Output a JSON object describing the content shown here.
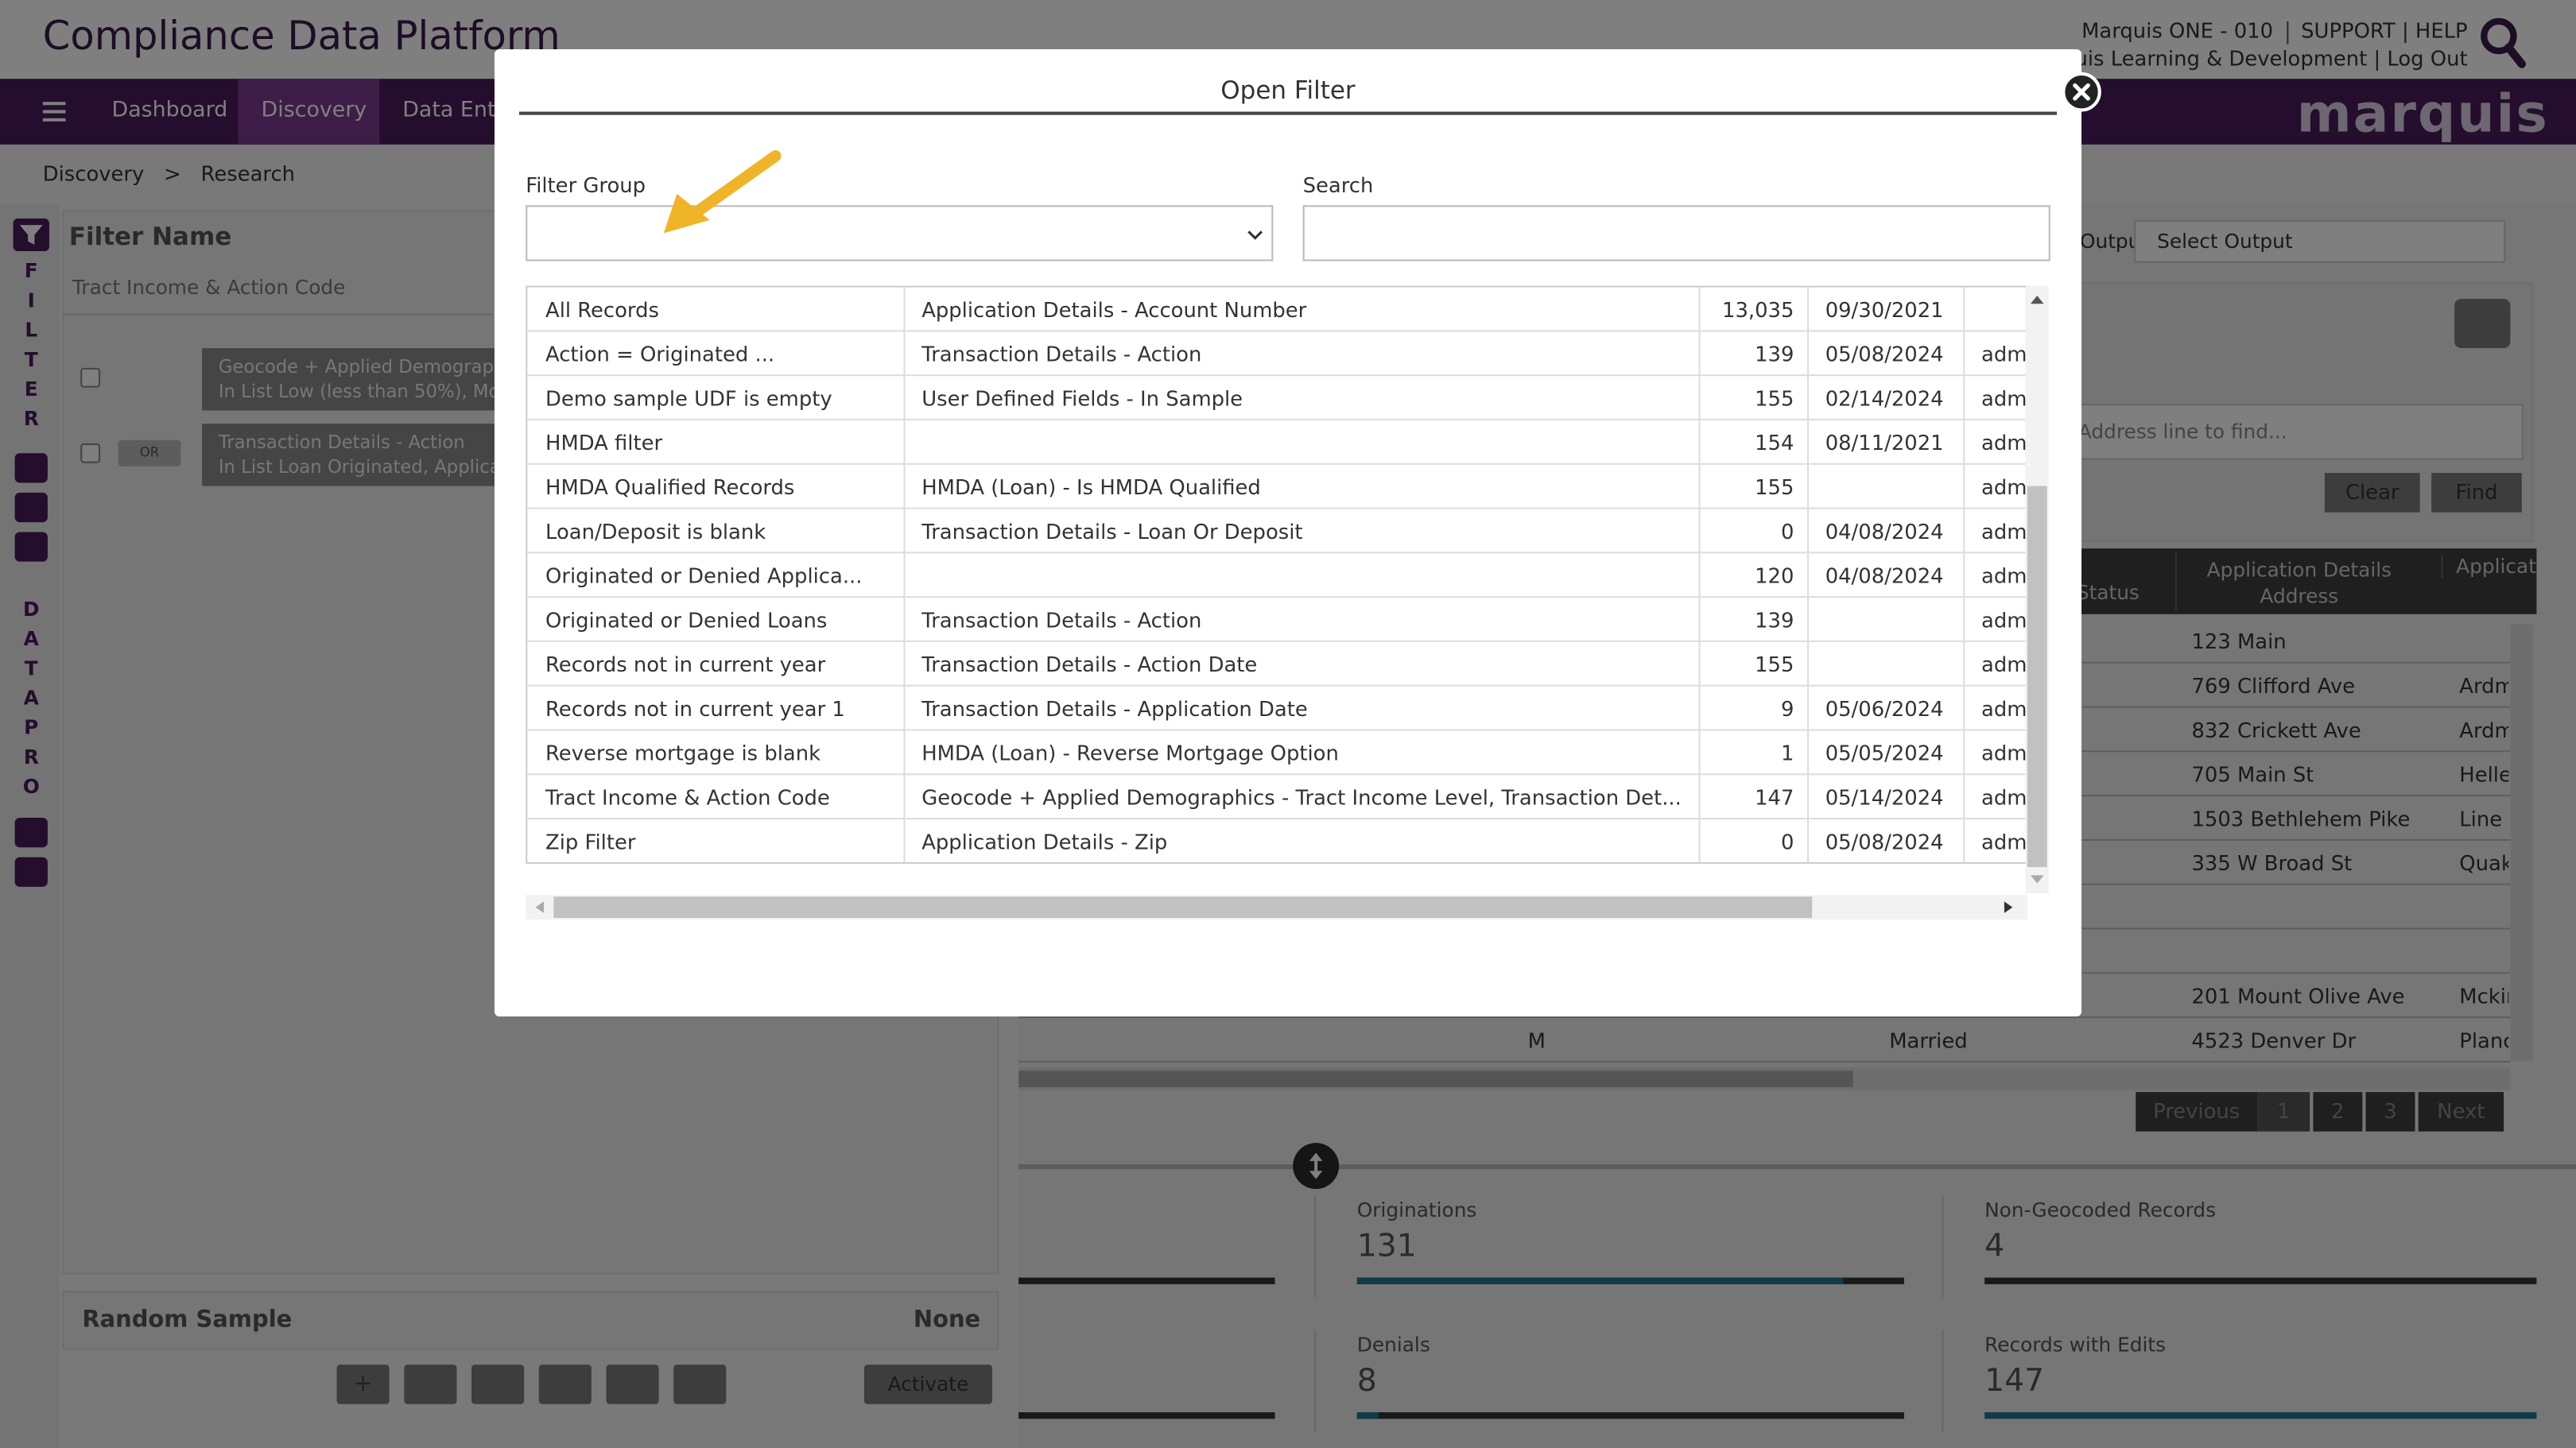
{
  "header": {
    "app_title": "Compliance Data Platform",
    "account": "Marquis ONE - 010",
    "support": "SUPPORT | HELP",
    "user_line": "Marquis Learning & Development | Log Out"
  },
  "nav": {
    "items": [
      "Dashboard",
      "Discovery",
      "Data Entry"
    ],
    "active": "Discovery",
    "logo": "marquis"
  },
  "breadcrumb": {
    "root": "Discovery",
    "sep": ">",
    "current": "Research"
  },
  "left_strip": {
    "word1": [
      "F",
      "I",
      "L",
      "T",
      "E",
      "R"
    ],
    "word2": [
      "D",
      "A",
      "T",
      "A",
      "P",
      "R",
      "O"
    ]
  },
  "filter_panel": {
    "name_label": "Filter Name",
    "name_value": "Tract Income & Action Code",
    "criteria": [
      {
        "line1": "Geocode + Applied Demographics",
        "line2": "In List Low (less than 50%), Mo"
      },
      {
        "line1": "Transaction Details - Action",
        "line2": "In List Loan Originated, Applica"
      }
    ],
    "or_label": "OR",
    "random_sample_label": "Random Sample",
    "random_sample_value": "None",
    "toolbar": {
      "add": "+",
      "activate": "Activate"
    }
  },
  "right_panel": {
    "output_label": "Output",
    "output_select": "Select Output",
    "address_placeholder": "Address line to find...",
    "clear": "Clear",
    "find": "Find",
    "col_status": "Status",
    "col_address": "Application Details Address",
    "col_next": "Applicat",
    "rows": [
      {
        "marital": "",
        "address": "123 Main",
        "next": ""
      },
      {
        "marital": "",
        "address": "769 Clifford Ave",
        "next": "Ardm"
      },
      {
        "marital": "",
        "address": "832 Crickett Ave",
        "next": "Ardm"
      },
      {
        "marital": "",
        "address": "705 Main St",
        "next": "Helle"
      },
      {
        "marital": "",
        "address": "1503 Bethlehem Pike",
        "next": "Line"
      },
      {
        "marital": "",
        "address": "335 W Broad St",
        "next": "Quak"
      },
      {
        "marital": "",
        "address": "",
        "next": ""
      },
      {
        "marital": "",
        "address": "",
        "next": ""
      },
      {
        "marital": "",
        "address": "201 Mount Olive Ave",
        "next": "Mckir"
      },
      {
        "sex": "M",
        "marital": "Married",
        "address": "4523 Denver Dr",
        "next": "Planc"
      }
    ],
    "pagination": {
      "previous": "Previous",
      "pages": [
        "1",
        "2",
        "3"
      ],
      "next": "Next"
    }
  },
  "stats": [
    {
      "label": "Originations",
      "value": "131",
      "fill": 0.89
    },
    {
      "label": "Non-Geocoded Records",
      "value": "4",
      "fill": 0.0
    },
    {
      "label": "Denials",
      "value": "8",
      "fill": 0.04
    },
    {
      "label": "Records with Edits",
      "value": "147",
      "fill": 1.0
    }
  ],
  "modal": {
    "title": "Open Filter",
    "filter_group_label": "Filter Group",
    "filter_group_value": "",
    "search_label": "Search",
    "search_value": "",
    "rows": [
      {
        "name": "All Records",
        "fields": "Application Details - Account Number",
        "count": "13,035",
        "date": "09/30/2021",
        "owner": ""
      },
      {
        "name": "Action = Originated ...",
        "fields": "Transaction Details - Action",
        "count": "139",
        "date": "05/08/2024",
        "owner": "adm"
      },
      {
        "name": "Demo sample UDF is empty",
        "fields": "User Defined Fields - In Sample",
        "count": "155",
        "date": "02/14/2024",
        "owner": "adm"
      },
      {
        "name": "HMDA filter",
        "fields": "",
        "count": "154",
        "date": "08/11/2021",
        "owner": "adm"
      },
      {
        "name": "HMDA Qualified Records",
        "fields": "HMDA (Loan) - Is HMDA Qualified",
        "count": "155",
        "date": "",
        "owner": "adm"
      },
      {
        "name": "Loan/Deposit is blank",
        "fields": "Transaction Details - Loan Or Deposit",
        "count": "0",
        "date": "04/08/2024",
        "owner": "adm"
      },
      {
        "name": "Originated or Denied Applica...",
        "fields": "",
        "count": "120",
        "date": "04/08/2024",
        "owner": "adm"
      },
      {
        "name": "Originated or Denied Loans",
        "fields": "Transaction Details - Action",
        "count": "139",
        "date": "",
        "owner": "adm"
      },
      {
        "name": "Records not in current year",
        "fields": "Transaction Details - Action Date",
        "count": "155",
        "date": "",
        "owner": "adm"
      },
      {
        "name": "Records not in current year 1",
        "fields": "Transaction Details - Application Date",
        "count": "9",
        "date": "05/06/2024",
        "owner": "adm"
      },
      {
        "name": "Reverse mortgage is blank",
        "fields": "HMDA (Loan) - Reverse Mortgage Option",
        "count": "1",
        "date": "05/05/2024",
        "owner": "adm"
      },
      {
        "name": "Tract Income & Action Code",
        "fields": "Geocode + Applied Demographics - Tract Income Level, Transaction Det...",
        "count": "147",
        "date": "05/14/2024",
        "owner": "adm"
      },
      {
        "name": "Zip Filter",
        "fields": "Application Details - Zip",
        "count": "0",
        "date": "05/08/2024",
        "owner": "adm"
      }
    ]
  },
  "colors": {
    "brand": "#4b1a5c",
    "nav_active": "#7b3a8f",
    "accent_bar": "#22788a",
    "annotation": "#f0b429"
  }
}
